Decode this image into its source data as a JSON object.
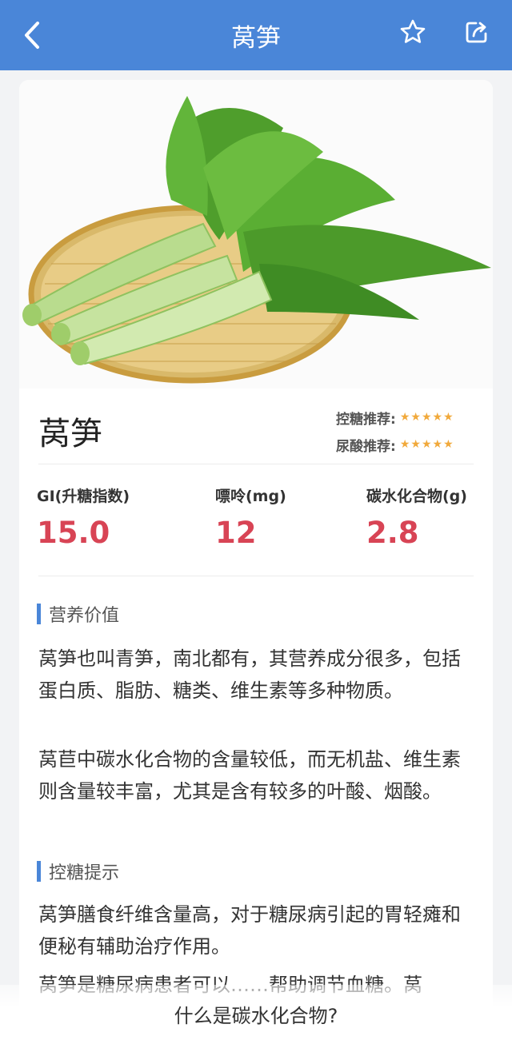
{
  "header": {
    "title": "莴笋",
    "back_icon": "chevron-left-icon",
    "favorite_icon": "star-outline-icon",
    "share_icon": "share-icon"
  },
  "food": {
    "name": "莴笋",
    "image_alt": "lettuce-stem-on-bamboo-tray"
  },
  "ratings": [
    {
      "label": "控糖推荐:",
      "stars": 5
    },
    {
      "label": "尿酸推荐:",
      "stars": 5
    }
  ],
  "metrics": [
    {
      "label": "GI(升糖指数)",
      "value": "15.0"
    },
    {
      "label": "嘌呤(mg)",
      "value": "12"
    },
    {
      "label": "碳水化合物(g)",
      "value": "2.8"
    }
  ],
  "sections": {
    "nutrition": {
      "title": "营养价值",
      "paragraphs": [
        "莴笋也叫青笋，南北都有，其营养成分很多，包括蛋白质、脂肪、糖类、维生素等多种物质。",
        "莴苣中碳水化合物的含量较低，而无机盐、维生素则含量较丰富，尤其是含有较多的叶酸、烟酸。"
      ]
    },
    "tips": {
      "title": "控糖提示",
      "paragraphs": [
        "莴笋膳食纤维含量高，对于糖尿病引起的胃轻瘫和便秘有辅助治疗作用。",
        "莴笋是糖尿病患者可以……帮助调节血糖。莴"
      ]
    }
  },
  "bottom_link": "什么是碳水化合物?",
  "colors": {
    "header_bg": "#4a86d8",
    "accent_bar": "#4a86d8",
    "value_red": "#d84455",
    "star_orange": "#f1a93b"
  }
}
